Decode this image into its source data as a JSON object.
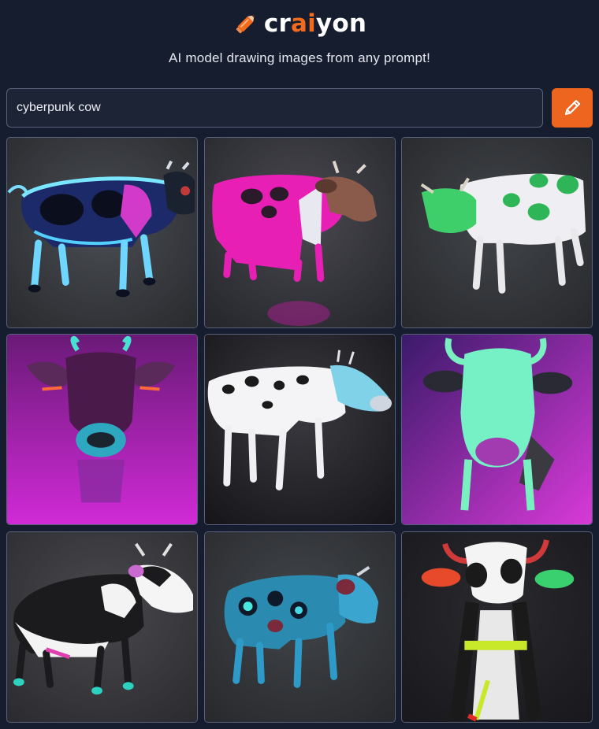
{
  "brand": {
    "name_prefix": "cr",
    "name_highlight": "ai",
    "name_suffix": "yon",
    "logo_icon": "pencil-icon",
    "accent_color": "#f26a1b"
  },
  "tagline": "AI model drawing images from any prompt!",
  "search": {
    "value": "cyberpunk cow",
    "button_icon": "pencil-icon",
    "button_color": "#ee6520"
  },
  "results": [
    {
      "subject": "neon blue and magenta cyber cow, side view"
    },
    {
      "subject": "hot pink robotic cow, side view"
    },
    {
      "subject": "white cow with green circuit-board spots"
    },
    {
      "subject": "purple cow head with glowing snout on magenta background"
    },
    {
      "subject": "black and white spotted cow with cyan head"
    },
    {
      "subject": "mint green cow head on purple background"
    },
    {
      "subject": "black and white holstein cow with neon hooves"
    },
    {
      "subject": "teal armored robot cow"
    },
    {
      "subject": "black and white cow with neon lights, front view"
    }
  ]
}
